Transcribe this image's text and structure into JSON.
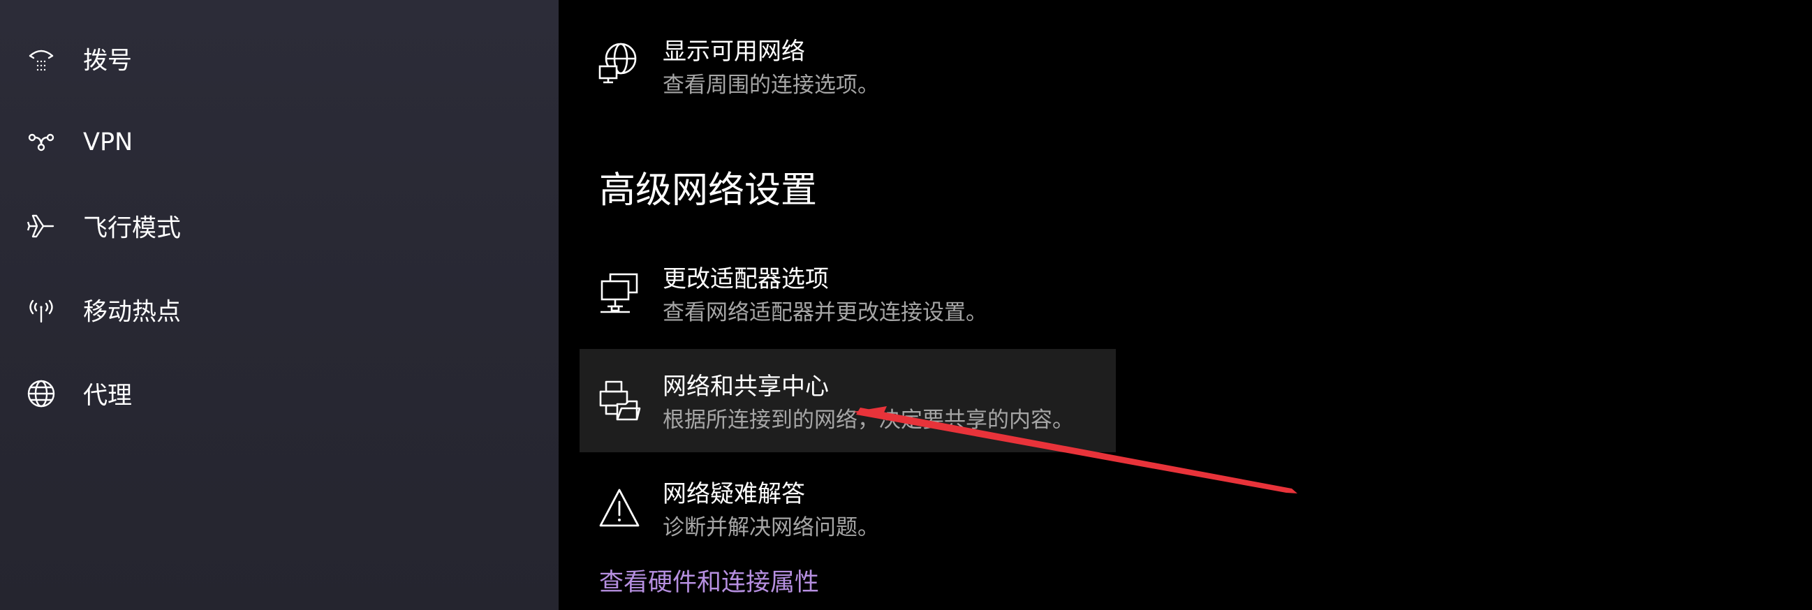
{
  "sidebar": {
    "items": [
      {
        "label": "拨号",
        "icon": "dial-up-icon"
      },
      {
        "label": "VPN",
        "icon": "vpn-icon"
      },
      {
        "label": "飞行模式",
        "icon": "airplane-icon"
      },
      {
        "label": "移动热点",
        "icon": "hotspot-icon"
      },
      {
        "label": "代理",
        "icon": "globe-icon"
      }
    ]
  },
  "main": {
    "show_networks": {
      "title": "显示可用网络",
      "description": "查看周围的连接选项。",
      "icon": "globe-network-icon"
    },
    "advanced_heading": "高级网络设置",
    "settings": [
      {
        "title": "更改适配器选项",
        "description": "查看网络适配器并更改连接设置。",
        "icon": "network-adapter-icon"
      },
      {
        "title": "网络和共享中心",
        "description": "根据所连接到的网络，决定要共享的内容。",
        "icon": "sharing-center-icon"
      },
      {
        "title": "网络疑难解答",
        "description": "诊断并解决网络问题。",
        "icon": "warning-icon"
      }
    ],
    "link": "查看硬件和连接属性"
  },
  "colors": {
    "sidebar_bg": "#2b2b36",
    "main_bg": "#000000",
    "hover_bg": "#1e1e1e",
    "link": "#b68fe0",
    "secondary_text": "#a6a6a6",
    "annotation_arrow": "#e8333a"
  }
}
